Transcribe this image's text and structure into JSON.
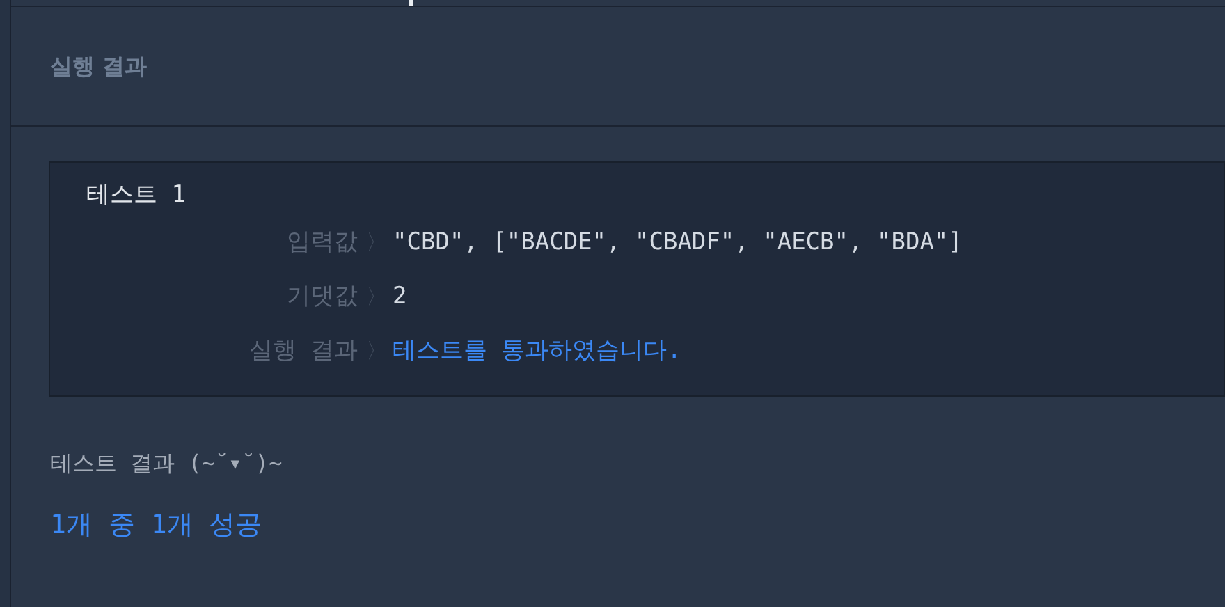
{
  "section_title": "실행 결과",
  "tests": [
    {
      "title": "테스트 1",
      "rows": [
        {
          "label": "입력값",
          "separator": "〉",
          "value": "\"CBD\", [\"BACDE\", \"CBADF\", \"AECB\", \"BDA\"]",
          "kind": "plain"
        },
        {
          "label": "기댓값",
          "separator": "〉",
          "value": "2",
          "kind": "plain"
        },
        {
          "label": "실행 결과",
          "separator": "〉",
          "value": "테스트를 통과하였습니다.",
          "kind": "pass"
        }
      ]
    }
  ],
  "summary": {
    "title": "테스트 결과 (~˘▾˘)~",
    "result": "1개 중 1개 성공"
  }
}
